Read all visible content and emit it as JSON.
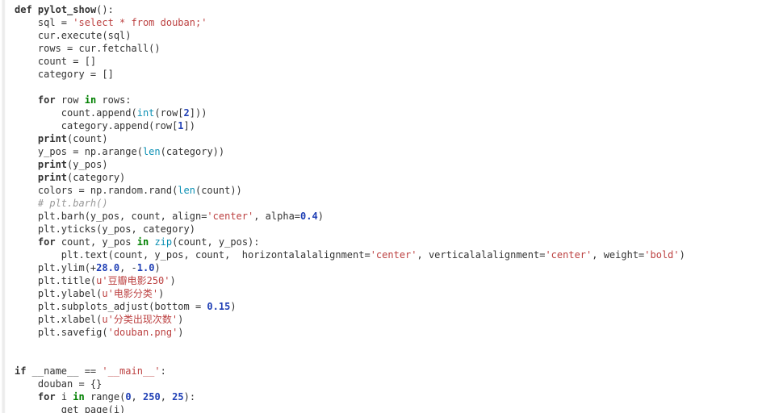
{
  "editor": {
    "language": "python",
    "background_color": "#ffffff",
    "default_text_color": "#333333",
    "font_size_px": 12,
    "line_height_px": 16
  },
  "syntax_colors": {
    "keyword": "#333333",
    "keyword_operator": "#008000",
    "string": "#bc4141",
    "number": "#1f3fb5",
    "builtin": "#0a8fb3",
    "comment": "#999999",
    "identifier": "#333333"
  },
  "code": {
    "lines": [
      "def pylot_show():",
      "    sql = 'select * from douban;'",
      "    cur.execute(sql)",
      "    rows = cur.fetchall()",
      "    count = []",
      "    category = []",
      "",
      "    for row in rows:",
      "        count.append(int(row[2]))",
      "        category.append(row[1])",
      "    print(count)",
      "    y_pos = np.arange(len(category))",
      "    print(y_pos)",
      "    print(category)",
      "    colors = np.random.rand(len(count))",
      "    # plt.barh()",
      "    plt.barh(y_pos, count, align='center', alpha=0.4)",
      "    plt.yticks(y_pos, category)",
      "    for count, y_pos in zip(count, y_pos):",
      "        plt.text(count, y_pos, count,  horizontalalalignment='center', verticalalalignment='center', weight='bold')",
      "    plt.ylim(+28.0, -1.0)",
      "    plt.title(u'豆瓣电影250')",
      "    plt.ylabel(u'电影分类')",
      "    plt.subplots_adjust(bottom = 0.15)",
      "    plt.xlabel(u'分类出现次数')",
      "    plt.savefig('douban.png')",
      "",
      "",
      "if __name__ == '__main__':",
      "    douban = {}",
      "    for i in range(0, 250, 25):",
      "        get_page(i)"
    ],
    "strings": [
      "'select * from douban;'",
      "'center'",
      "'center'",
      "'bold'",
      "u'豆瓣电影250'",
      "u'电影分类'",
      "u'分类出现次数'",
      "'douban.png'",
      "'__main__'"
    ],
    "numbers": [
      "2",
      "1",
      "0.4",
      "28.0",
      "1.0",
      "0.15",
      "0",
      "250",
      "25"
    ],
    "keywords": [
      "def",
      "for",
      "in",
      "print",
      "if"
    ],
    "builtins": [
      "int",
      "len",
      "zip"
    ],
    "comment": "# plt.barh()",
    "function_name": "pylot_show",
    "titles_cn": {
      "title": "豆瓣电影250",
      "ylabel": "电影分类",
      "xlabel": "分类出现次数"
    }
  },
  "tokens": {
    "l1": [
      [
        "def",
        "t-kw"
      ],
      [
        " ",
        "t-punc"
      ],
      [
        "pylot_show",
        "t-name"
      ],
      [
        "():",
        "t-punc"
      ]
    ],
    "l2": [
      [
        "    sql = ",
        "t-id"
      ],
      [
        "'select * from douban;'",
        "t-str"
      ]
    ],
    "l3": [
      [
        "    cur.execute(sql)",
        "t-id"
      ]
    ],
    "l4": [
      [
        "    rows = cur.fetchall()",
        "t-id"
      ]
    ],
    "l5": [
      [
        "    count = []",
        "t-id"
      ]
    ],
    "l6": [
      [
        "    category = []",
        "t-id"
      ]
    ],
    "l7": [
      [
        "",
        "t-id"
      ]
    ],
    "l8": [
      [
        "    ",
        "t-id"
      ],
      [
        "for",
        "t-kw"
      ],
      [
        " row ",
        "t-id"
      ],
      [
        "in",
        "t-op-kw"
      ],
      [
        " rows:",
        "t-id"
      ]
    ],
    "l9": [
      [
        "        count.append(",
        "t-id"
      ],
      [
        "int",
        "t-builtin"
      ],
      [
        "(row[",
        "t-id"
      ],
      [
        "2",
        "t-num"
      ],
      [
        "]))",
        "t-id"
      ]
    ],
    "l10": [
      [
        "        category.append(row[",
        "t-id"
      ],
      [
        "1",
        "t-num"
      ],
      [
        "])",
        "t-id"
      ]
    ],
    "l11": [
      [
        "    ",
        "t-id"
      ],
      [
        "print",
        "t-kw"
      ],
      [
        "(count)",
        "t-id"
      ]
    ],
    "l12": [
      [
        "    y_pos = np.arange(",
        "t-id"
      ],
      [
        "len",
        "t-builtin"
      ],
      [
        "(category))",
        "t-id"
      ]
    ],
    "l13": [
      [
        "    ",
        "t-id"
      ],
      [
        "print",
        "t-kw"
      ],
      [
        "(y_pos)",
        "t-id"
      ]
    ],
    "l14": [
      [
        "    ",
        "t-id"
      ],
      [
        "print",
        "t-kw"
      ],
      [
        "(category)",
        "t-id"
      ]
    ],
    "l15": [
      [
        "    colors = np.random.rand(",
        "t-id"
      ],
      [
        "len",
        "t-builtin"
      ],
      [
        "(count))",
        "t-id"
      ]
    ],
    "l16": [
      [
        "    # plt.barh()",
        "t-com"
      ]
    ],
    "l17": [
      [
        "    plt.barh(y_pos, count, align=",
        "t-id"
      ],
      [
        "'center'",
        "t-str"
      ],
      [
        ", alpha=",
        "t-id"
      ],
      [
        "0.4",
        "t-num"
      ],
      [
        ")",
        "t-id"
      ]
    ],
    "l18": [
      [
        "    plt.yticks(y_pos, category)",
        "t-id"
      ]
    ],
    "l19": [
      [
        "    ",
        "t-id"
      ],
      [
        "for",
        "t-kw"
      ],
      [
        " count, y_pos ",
        "t-id"
      ],
      [
        "in",
        "t-op-kw"
      ],
      [
        " ",
        "t-id"
      ],
      [
        "zip",
        "t-builtin"
      ],
      [
        "(count, y_pos):",
        "t-id"
      ]
    ],
    "l20": [
      [
        "        plt.text(count, y_pos, count,  horizontalalalignment=",
        "t-id"
      ],
      [
        "'center'",
        "t-str"
      ],
      [
        ", verticalalalignment=",
        "t-id"
      ],
      [
        "'center'",
        "t-str"
      ],
      [
        ", weight=",
        "t-id"
      ],
      [
        "'bold'",
        "t-str"
      ],
      [
        ")",
        "t-id"
      ]
    ],
    "l21": [
      [
        "    plt.ylim(+",
        "t-id"
      ],
      [
        "28.0",
        "t-num"
      ],
      [
        ", -",
        "t-id"
      ],
      [
        "1.0",
        "t-num"
      ],
      [
        ")",
        "t-id"
      ]
    ],
    "l22": [
      [
        "    plt.title(",
        "t-id"
      ],
      [
        "u'豆瓣电影250'",
        "t-str"
      ],
      [
        ")",
        "t-id"
      ]
    ],
    "l23": [
      [
        "    plt.ylabel(",
        "t-id"
      ],
      [
        "u'电影分类'",
        "t-str"
      ],
      [
        ")",
        "t-id"
      ]
    ],
    "l24": [
      [
        "    plt.subplots_adjust(bottom = ",
        "t-id"
      ],
      [
        "0.15",
        "t-num"
      ],
      [
        ")",
        "t-id"
      ]
    ],
    "l25": [
      [
        "    plt.xlabel(",
        "t-id"
      ],
      [
        "u'分类出现次数'",
        "t-str"
      ],
      [
        ")",
        "t-id"
      ]
    ],
    "l26": [
      [
        "    plt.savefig(",
        "t-id"
      ],
      [
        "'douban.png'",
        "t-str"
      ],
      [
        ")",
        "t-id"
      ]
    ],
    "l27": [
      [
        "",
        "t-id"
      ]
    ],
    "l28": [
      [
        "",
        "t-id"
      ]
    ],
    "l29": [
      [
        "if",
        "t-kw"
      ],
      [
        " __name__ == ",
        "t-id"
      ],
      [
        "'__main__'",
        "t-str"
      ],
      [
        ":",
        "t-id"
      ]
    ],
    "l30": [
      [
        "    douban = {}",
        "t-id"
      ]
    ],
    "l31": [
      [
        "    ",
        "t-id"
      ],
      [
        "for",
        "t-kw"
      ],
      [
        " i ",
        "t-id"
      ],
      [
        "in",
        "t-op-kw"
      ],
      [
        " range(",
        "t-id"
      ],
      [
        "0",
        "t-num"
      ],
      [
        ", ",
        "t-id"
      ],
      [
        "250",
        "t-num"
      ],
      [
        ", ",
        "t-id"
      ],
      [
        "25",
        "t-num"
      ],
      [
        "):",
        "t-id"
      ]
    ],
    "l32": [
      [
        "        get_page(i)",
        "t-id"
      ]
    ]
  }
}
